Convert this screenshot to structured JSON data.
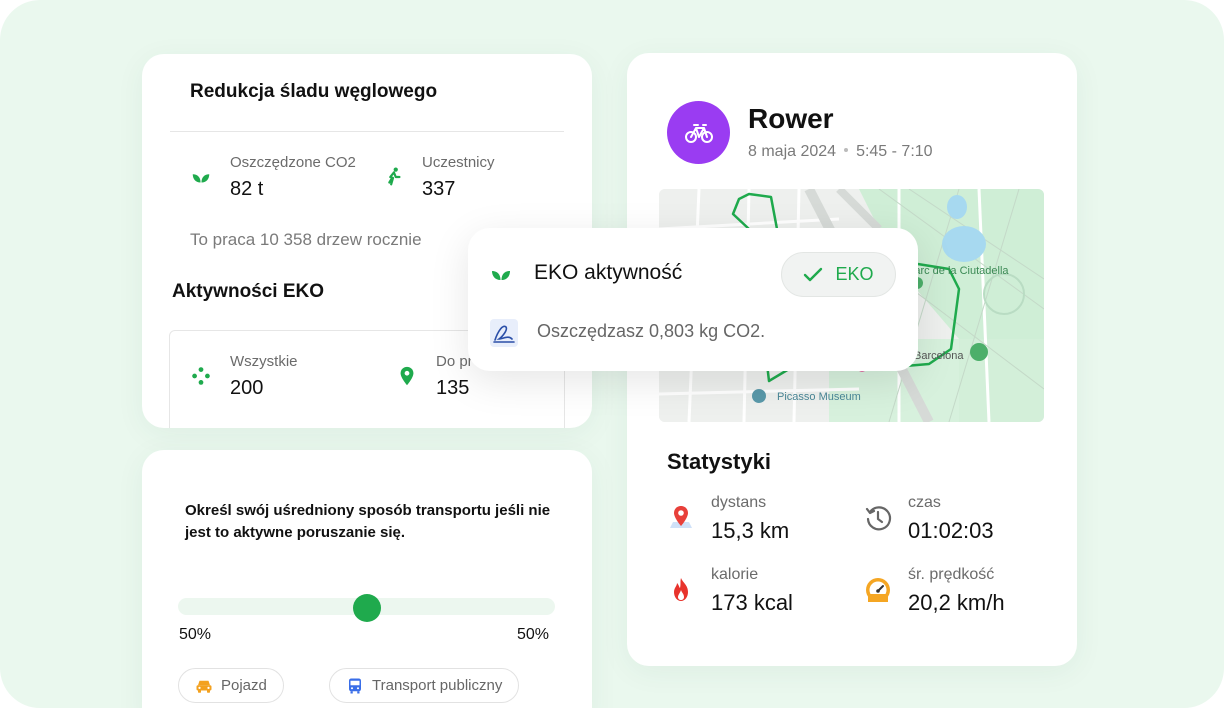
{
  "carbon": {
    "title": "Redukcja śladu węglowego",
    "saved": {
      "label": "Oszczędzone CO2",
      "value": "82 t"
    },
    "participants": {
      "label": "Uczestnicy",
      "value": "337"
    },
    "note": "To praca 10 358 drzew rocznie"
  },
  "eco_activities": {
    "title": "Aktywności EKO",
    "all": {
      "label": "Wszystkie",
      "value": "200"
    },
    "second": {
      "label": "Do pr",
      "value": "135"
    }
  },
  "transport": {
    "question": "Określ swój uśredniony sposób transportu jeśli nie jest to aktywne poruszanie się.",
    "slider_value": 0.5,
    "left_pct": "50%",
    "right_pct": "50%",
    "options": [
      {
        "label": "Pojazd",
        "icon": "car-icon"
      },
      {
        "label": "Transport publiczny",
        "icon": "bus-icon"
      }
    ]
  },
  "activity": {
    "title": "Rower",
    "date": "8 maja 2024",
    "time": "5:45 - 7:10",
    "icon": "bicycle-icon",
    "accent": "#9a3cf2",
    "map_labels": {
      "park": "Parc de la Ciutadella",
      "museum": "Picasso Museum",
      "city": "Barcelona"
    },
    "stats_title": "Statystyki",
    "stats": {
      "distance": {
        "label": "dystans",
        "value": "15,3 km"
      },
      "time": {
        "label": "czas",
        "value": "01:02:03"
      },
      "calories": {
        "label": "kalorie",
        "value": "173 kcal"
      },
      "speed": {
        "label": "śr. prędkość",
        "value": "20,2 km/h"
      }
    }
  },
  "eco_popup": {
    "title": "EKO aktywność",
    "badge": "EKO",
    "message": "Oszczędzasz 0,803 kg CO2."
  },
  "colors": {
    "green": "#1faa4d",
    "purple": "#9a3cf2",
    "background": "#eaf8ee"
  }
}
